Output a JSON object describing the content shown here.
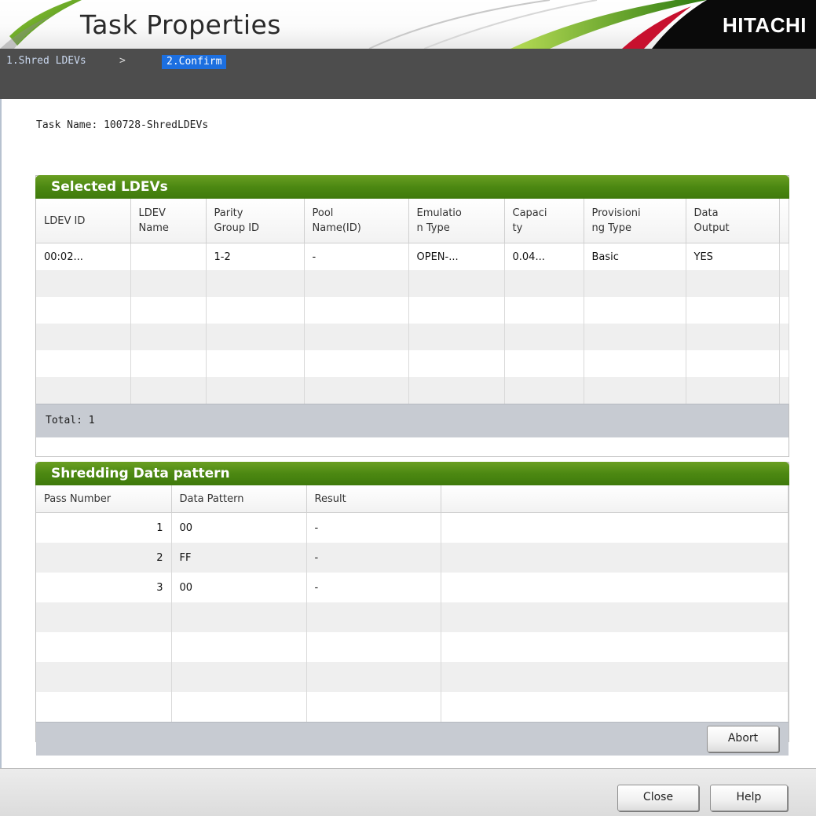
{
  "header": {
    "title": "Task Properties",
    "brand": "HITACHI",
    "accent_green": "#5a9a1c",
    "accent_red": "#c8102e"
  },
  "breadcrumb": {
    "step1": "1.Shred LDEVs",
    "separator": ">",
    "step2": "2.Confirm"
  },
  "task": {
    "label": "Task Name:",
    "value": "100728-ShredLDEVs",
    "text": "Task Name: 100728-ShredLDEVs"
  },
  "selected_ldevs": {
    "title": "Selected LDEVs",
    "columns": [
      "LDEV ID",
      "LDEV Name",
      "Parity Group ID",
      "Pool Name(ID)",
      "Emulation Type",
      "Capacity",
      "Provisioning Type",
      "Data Output"
    ],
    "columns_display": [
      "LDEV ID",
      "LDEV\nName",
      "Parity\nGroup ID",
      "Pool\nName(ID)",
      "Emulatio\nn Type",
      "Capaci\nty",
      "Provisioni\nng Type",
      "Data\nOutput"
    ],
    "rows": [
      [
        "00:02...",
        "",
        "1-2",
        "-",
        "OPEN-...",
        "0.04...",
        "Basic",
        "YES"
      ]
    ],
    "total_text": "Total:  1"
  },
  "shredding": {
    "title": "Shredding Data pattern",
    "columns": [
      "Pass Number",
      "Data Pattern",
      "Result"
    ],
    "rows": [
      [
        "1",
        "00",
        "-"
      ],
      [
        "2",
        "FF",
        "-"
      ],
      [
        "3",
        "00",
        "-"
      ]
    ],
    "abort_label": "Abort"
  },
  "footer": {
    "close_label": "Close",
    "help_label": "Help"
  }
}
